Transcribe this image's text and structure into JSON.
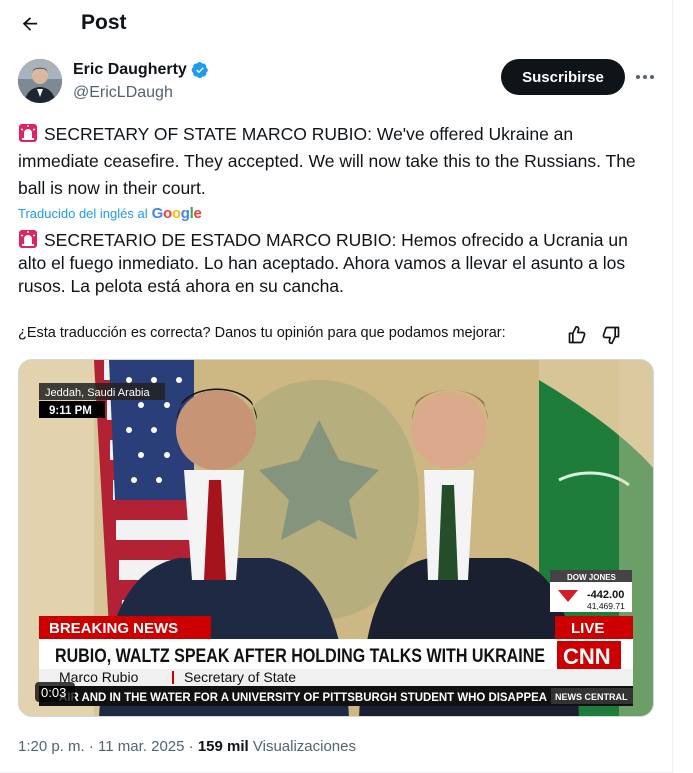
{
  "header": {
    "title": "Post"
  },
  "author": {
    "name": "Eric Daugherty",
    "handle": "@EricLDaugh"
  },
  "actions": {
    "subscribe_label": "Suscribirse"
  },
  "tweet": {
    "text": "SECRETARY OF STATE MARCO RUBIO: We've offered Ukraine an immediate ceasefire. They accepted. We will now take this to the Russians. The ball is now in their court.",
    "translated_label": "Traducido del inglés al",
    "translator": "Google",
    "translation": "SECRETARIO DE ESTADO MARCO RUBIO: Hemos ofrecido a Ucrania un alto el fuego inmediato. Lo han aceptado. Ahora vamos a llevar el asunto a los rusos. La pelota está ahora en su cancha.",
    "feedback_prompt": "¿Esta traducción es correcta? Danos tu opinión para que podamos mejorar:"
  },
  "video": {
    "location": "Jeddah, Saudi Arabia",
    "local_time": "9:11 PM",
    "breaking": "BREAKING NEWS",
    "headline": "RUBIO, WALTZ SPEAK AFTER HOLDING TALKS WITH UKRAINE",
    "speaker": "Marco Rubio",
    "speaker_title": "Secretary of State",
    "ticker": "AIR AND IN THE WATER FOR A UNIVERSITY OF PITTSBURGH STUDENT WHO DISAPPEA",
    "network": "CNN",
    "live": "LIVE",
    "dow_label": "DOW JONES",
    "dow_change": "-442.00",
    "dow_value": "41,469.71",
    "news_central": "NEWS CENTRAL",
    "elapsed": "0:03"
  },
  "meta": {
    "time": "1:20 p. m. · 11 mar. 2025 ·",
    "views": "159 mil",
    "views_label": "Visualizaciones"
  },
  "colors": {
    "accent": "#1d9bf0",
    "subscribe_bg": "#0f1419",
    "cnn_red": "#cc0000"
  }
}
